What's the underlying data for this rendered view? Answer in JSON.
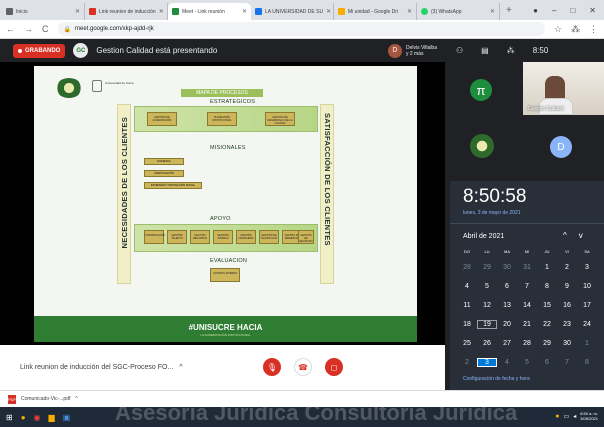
{
  "browser": {
    "tabs": [
      {
        "label": "Inicio",
        "color": "#5f6368"
      },
      {
        "label": "Link reunion de inducción",
        "color": "#d93025"
      },
      {
        "label": "Meet - Link reunión",
        "color": "#1e8e3e",
        "active": true
      },
      {
        "label": "LA UNIVERSIDAD DE SU",
        "color": "#1a73e8"
      },
      {
        "label": "Mi unidad - Google Dri",
        "color": "#f9ab00"
      },
      {
        "label": "(3) WhatsApp",
        "color": "#25d366"
      }
    ],
    "url": "meet.google.com/xkp-ajdd-rjk"
  },
  "meet": {
    "recording_label": "GRABANDO",
    "presenting_text": "Gestion Calidad está presentando",
    "presenter_initial": "D",
    "presenter_name": "Delvis Villalba",
    "presenter_extra": "y 2 más",
    "top_count": "8:50",
    "meeting_name": "Link reunion de inducción del SGC-Proceso FO...",
    "self_name": "Gestion Calidad",
    "participant_initial": "D",
    "pi_initial": "π"
  },
  "slide": {
    "map_title": "MAPA DE PROCESOS",
    "left_vertical": "NECESIDADES DE LOS CLIENTES",
    "right_vertical": "SATISFACCIÓN DE LOS CLIENTES",
    "strategic": "ESTRATEGICOS",
    "missional": "MISIONALES",
    "support": "APOYO",
    "evaluation": "EVALUACION",
    "footer_title": "#UNISUCRE HACIA",
    "footer_sub": "LA ACREDITACIÓN INSTITUCIONAL",
    "logo_text": "Universidad de Sucre"
  },
  "clock": {
    "time": "8:50:58",
    "date": "lunes, 3 de mayo de 2021",
    "month": "Abril de 2021",
    "days_of_week": [
      "DO",
      "LU",
      "MA",
      "MI",
      "JU",
      "VI",
      "SA"
    ],
    "weeks": [
      [
        "28",
        "29",
        "30",
        "31",
        "1",
        "2",
        "3"
      ],
      [
        "4",
        "5",
        "6",
        "7",
        "8",
        "9",
        "10"
      ],
      [
        "11",
        "12",
        "13",
        "14",
        "15",
        "16",
        "17"
      ],
      [
        "18",
        "19",
        "20",
        "21",
        "22",
        "23",
        "24"
      ],
      [
        "25",
        "26",
        "27",
        "28",
        "29",
        "30",
        "1"
      ],
      [
        "2",
        "3",
        "4",
        "5",
        "6",
        "7",
        "8"
      ]
    ],
    "link": "Configuración de fecha y hora"
  },
  "download": {
    "file": "Comunicado-Vic-...pdf"
  },
  "taskbar": {
    "ghost_text": "Asesoría Jurídica Consultoría Jurídica",
    "time": "8:50 a. m.",
    "date": "3/05/2021"
  }
}
